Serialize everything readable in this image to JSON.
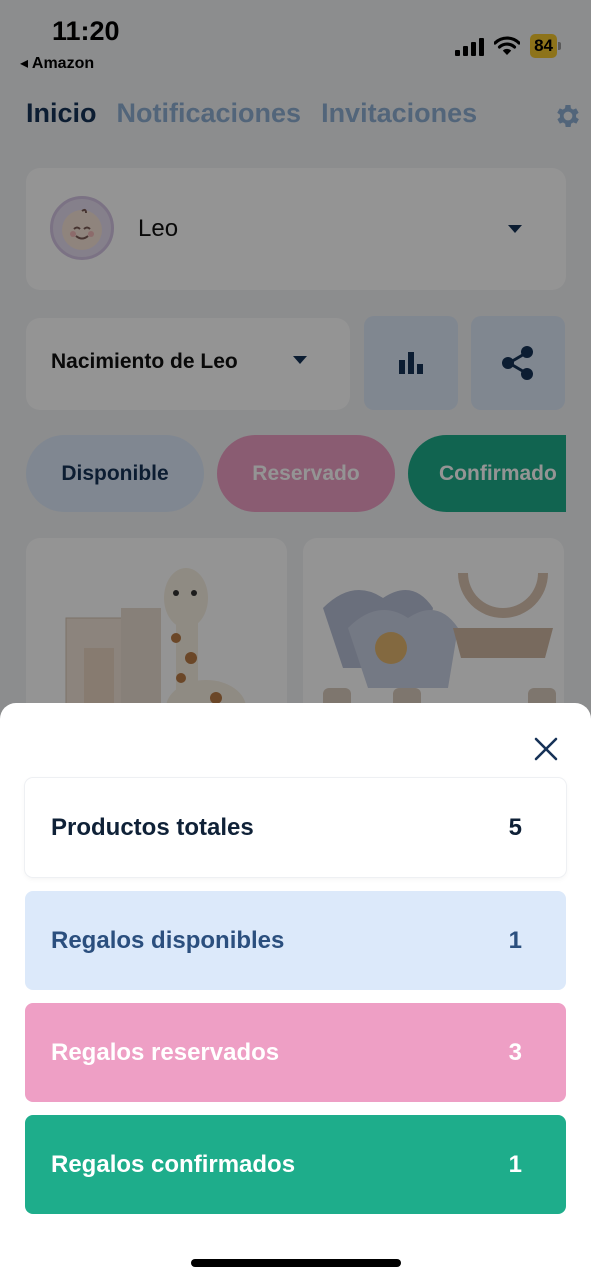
{
  "status_bar": {
    "time": "11:20",
    "back_label": "◂ Amazon",
    "battery": "84"
  },
  "tabs": [
    {
      "label": "Inicio"
    },
    {
      "label": "Notificaciones"
    },
    {
      "label": "Invitaciones"
    }
  ],
  "profile": {
    "name": "Leo"
  },
  "event": {
    "name": "Nacimiento de Leo"
  },
  "filters": [
    {
      "label": "Disponible"
    },
    {
      "label": "Reservado"
    },
    {
      "label": "Confirmado"
    }
  ],
  "stats_sheet": {
    "rows": [
      {
        "label": "Productos totales",
        "value": "5"
      },
      {
        "label": "Regalos disponibles",
        "value": "1"
      },
      {
        "label": "Regalos reservados",
        "value": "3"
      },
      {
        "label": "Regalos confirmados",
        "value": "1"
      }
    ]
  },
  "colors": {
    "primary": "#163257",
    "available": "#dce9fa",
    "reserved": "#ee9fc5",
    "confirmed": "#1ead8b"
  },
  "icons": [
    "gear-icon",
    "chevron-down-icon",
    "bar-chart-icon",
    "share-icon",
    "close-icon"
  ]
}
